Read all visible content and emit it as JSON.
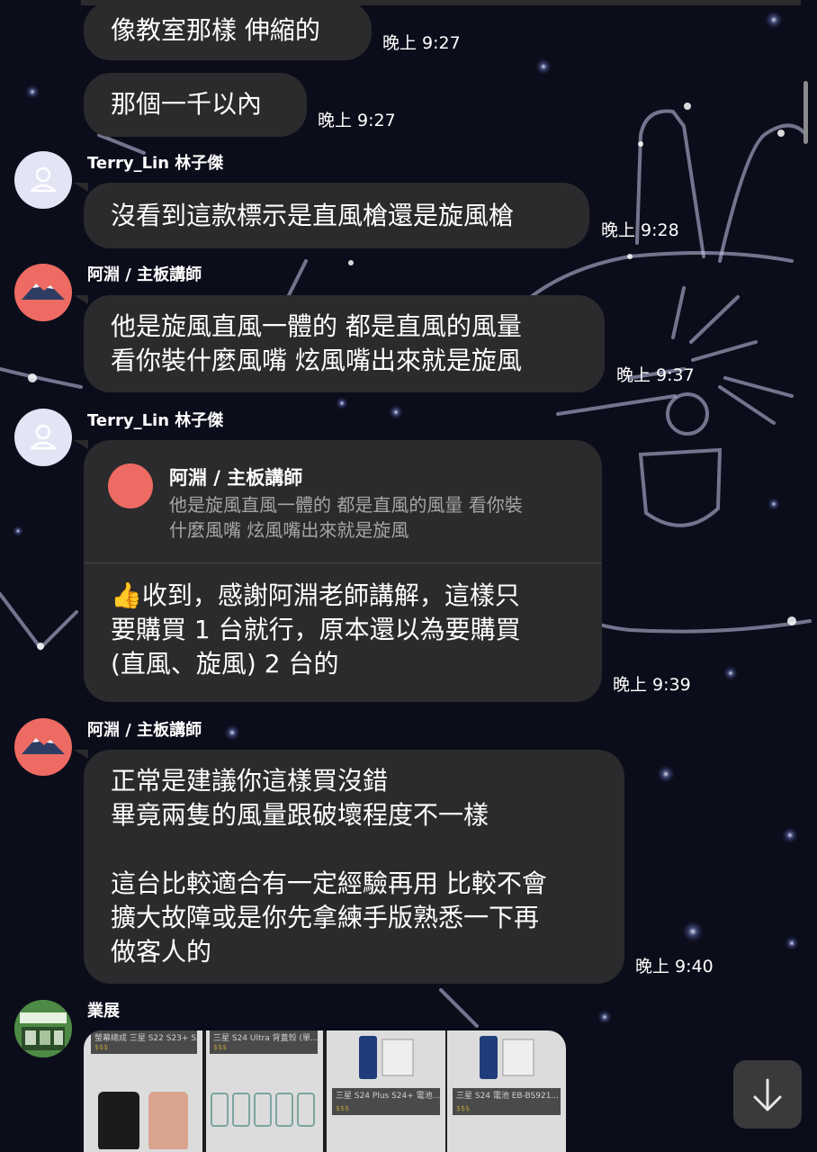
{
  "messages": {
    "m1": {
      "text": "像教室那樣 伸縮的",
      "time": "晚上 9:27"
    },
    "m2": {
      "text": "那個一千以內",
      "time": "晚上 9:27"
    },
    "m3": {
      "sender": "Terry_Lin 林子傑",
      "text": "沒看到這款標示是直風槍還是旋風槍",
      "time": "晚上 9:28"
    },
    "m4": {
      "sender": "阿淵 / 主板講師",
      "text": "他是旋風直風一體的 都是直風的風量\n看你裝什麼風嘴 炫風嘴出來就是旋風",
      "time": "晚上 9:37"
    },
    "m5": {
      "sender": "Terry_Lin 林子傑",
      "quote_sender": "阿淵 / 主板講師",
      "quote_text": "他是旋風直風一體的 都是直風的風量 看你裝\n什麼風嘴 炫風嘴出來就是旋風",
      "text": "👍收到，感謝阿淵老師講解，這樣只\n要購買 1 台就行，原本還以為要購買\n(直風、旋風) 2 台的",
      "time": "晚上 9:39"
    },
    "m6": {
      "sender": "阿淵 / 主板講師",
      "text": "正常是建議你這樣買沒錯\n畢竟兩隻的風量跟破壞程度不一樣\n\n這台比較適合有一定經驗再用 比較不會\n擴大故障或是你先拿練手版熟悉一下再\n做客人的",
      "time": "晚上 9:40"
    },
    "m7": {
      "sender": "業展",
      "cards": [
        {
          "title": "螢幕總成 三星 S22 S23+ S2...",
          "price": "$$$"
        },
        {
          "title": "三星 S24 Ultra 背蓋殼 (單...",
          "price": "$$$"
        },
        {
          "title": "三星 S24 Plus S24+ 電池...",
          "price": "$$$"
        },
        {
          "title": "三星 S24 電池 EB-BS921...",
          "price": "$$$"
        }
      ]
    }
  },
  "icons": {
    "default_avatar": "person-icon",
    "mountain_avatar": "mountain-icon",
    "store_avatar": "store-photo",
    "scroll": "arrow-down-icon",
    "thumbs_up": "thumbs-up-emoji"
  },
  "colors": {
    "bubble": "#2b2b2d",
    "background": "#0c0d1a",
    "mountain_avatar": "#ee6b63",
    "default_avatar": "#e3e4f4"
  }
}
